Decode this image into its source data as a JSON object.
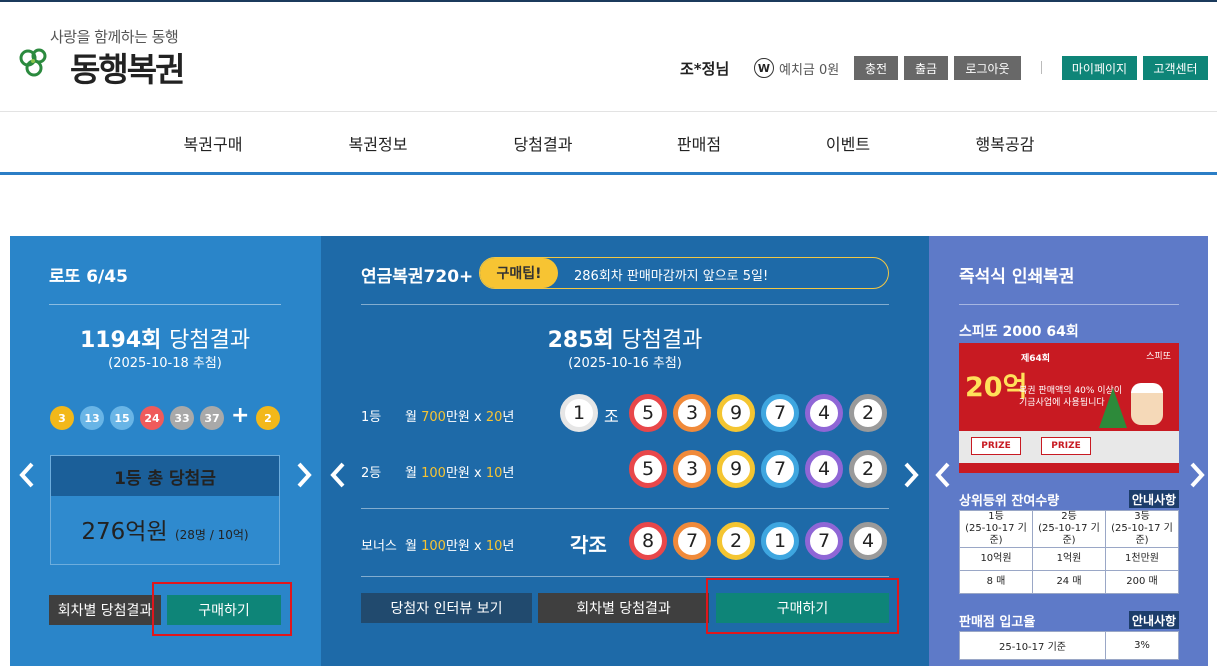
{
  "header": {
    "slogan": "사랑을 함께하는 동행",
    "site_name": "동행복권",
    "user_name": "조*정님",
    "wallet_icon": "W",
    "deposit": "예치금 0원",
    "buttons": {
      "charge": "충전",
      "withdraw": "출금",
      "logout": "로그아웃",
      "mypage": "마이페이지",
      "support": "고객센터"
    }
  },
  "nav": [
    "복권구매",
    "복권정보",
    "당첨결과",
    "판매점",
    "이벤트",
    "행복공감"
  ],
  "lotto": {
    "title": "로또 6/45",
    "round_num": "1194회",
    "round_suffix": "당첨결과",
    "date": "(2025-10-18 추첨)",
    "balls": [
      {
        "n": "3",
        "color": "#f2b81a"
      },
      {
        "n": "13",
        "color": "#69b5e6"
      },
      {
        "n": "15",
        "color": "#69b5e6"
      },
      {
        "n": "24",
        "color": "#ef5b5b"
      },
      {
        "n": "33",
        "color": "#a9a9a9"
      },
      {
        "n": "37",
        "color": "#a9a9a9"
      }
    ],
    "plus": "+",
    "bonus": {
      "n": "2",
      "color": "#f2b81a"
    },
    "prize_title": "1등 총 당첨금",
    "prize_value": "276억원",
    "prize_detail": "(28명 / 10억)",
    "btn_history": "회차별 당첨결과",
    "btn_buy": "구매하기"
  },
  "pension": {
    "title": "연금복권720+",
    "tip_label": "구매팁!",
    "tip_text": "286회차 판매마감까지 앞으로 5일!",
    "round_num": "285회",
    "round_suffix": "당첨결과",
    "date": "(2025-10-16 추첨)",
    "rank1": {
      "label": "1등",
      "prefix": "월",
      "amount": "700",
      "mid": "만원 x",
      "years": "20",
      "suffix": "년",
      "group": "1",
      "jo": "조",
      "digits": [
        "5",
        "3",
        "9",
        "7",
        "4",
        "2"
      ]
    },
    "rank2": {
      "label": "2등",
      "prefix": "월",
      "amount": "100",
      "mid": "만원 x",
      "years": "10",
      "suffix": "년",
      "digits": [
        "5",
        "3",
        "9",
        "7",
        "4",
        "2"
      ]
    },
    "bonus": {
      "label": "보너스",
      "prefix": "월",
      "amount": "100",
      "mid": "만원 x",
      "years": "10",
      "suffix": "년",
      "gakjo": "각조",
      "digits": [
        "8",
        "7",
        "2",
        "1",
        "7",
        "4"
      ]
    },
    "digit_colors": [
      "#e8474a",
      "#f08a3a",
      "#f4c531",
      "#3ea6e0",
      "#8f66d6",
      "#9a9a9a"
    ],
    "btn_interview": "당첨자 인터뷰 보기",
    "btn_history": "회차별 당첨결과",
    "btn_buy": "구매하기"
  },
  "instant": {
    "title": "즉석식 인쇄복권",
    "game_title": "스피또 2000 64회",
    "ticket_round": "제64회",
    "ticket_amount": "20억",
    "ticket_text": "복권 판매액의 40% 이상이 기금사업에 사용됩니다",
    "ticket_brand": "스피또",
    "prize_label": "PRIZE",
    "remain_title": "상위등위 잔여수량",
    "info_label": "안내사항",
    "remain_table": {
      "headers": [
        {
          "rank": "1등",
          "date": "(25-10-17 기준)"
        },
        {
          "rank": "2등",
          "date": "(25-10-17 기준)"
        },
        {
          "rank": "3등",
          "date": "(25-10-17 기준)"
        }
      ],
      "amounts": [
        "10억원",
        "1억원",
        "1천만원"
      ],
      "counts": [
        "8 매",
        "24 매",
        "200 매"
      ]
    },
    "sales_title": "판매점 입고율",
    "sales_info_label": "안내사항",
    "sales_date": "25-10-17 기준",
    "sales_rate": "3%"
  }
}
